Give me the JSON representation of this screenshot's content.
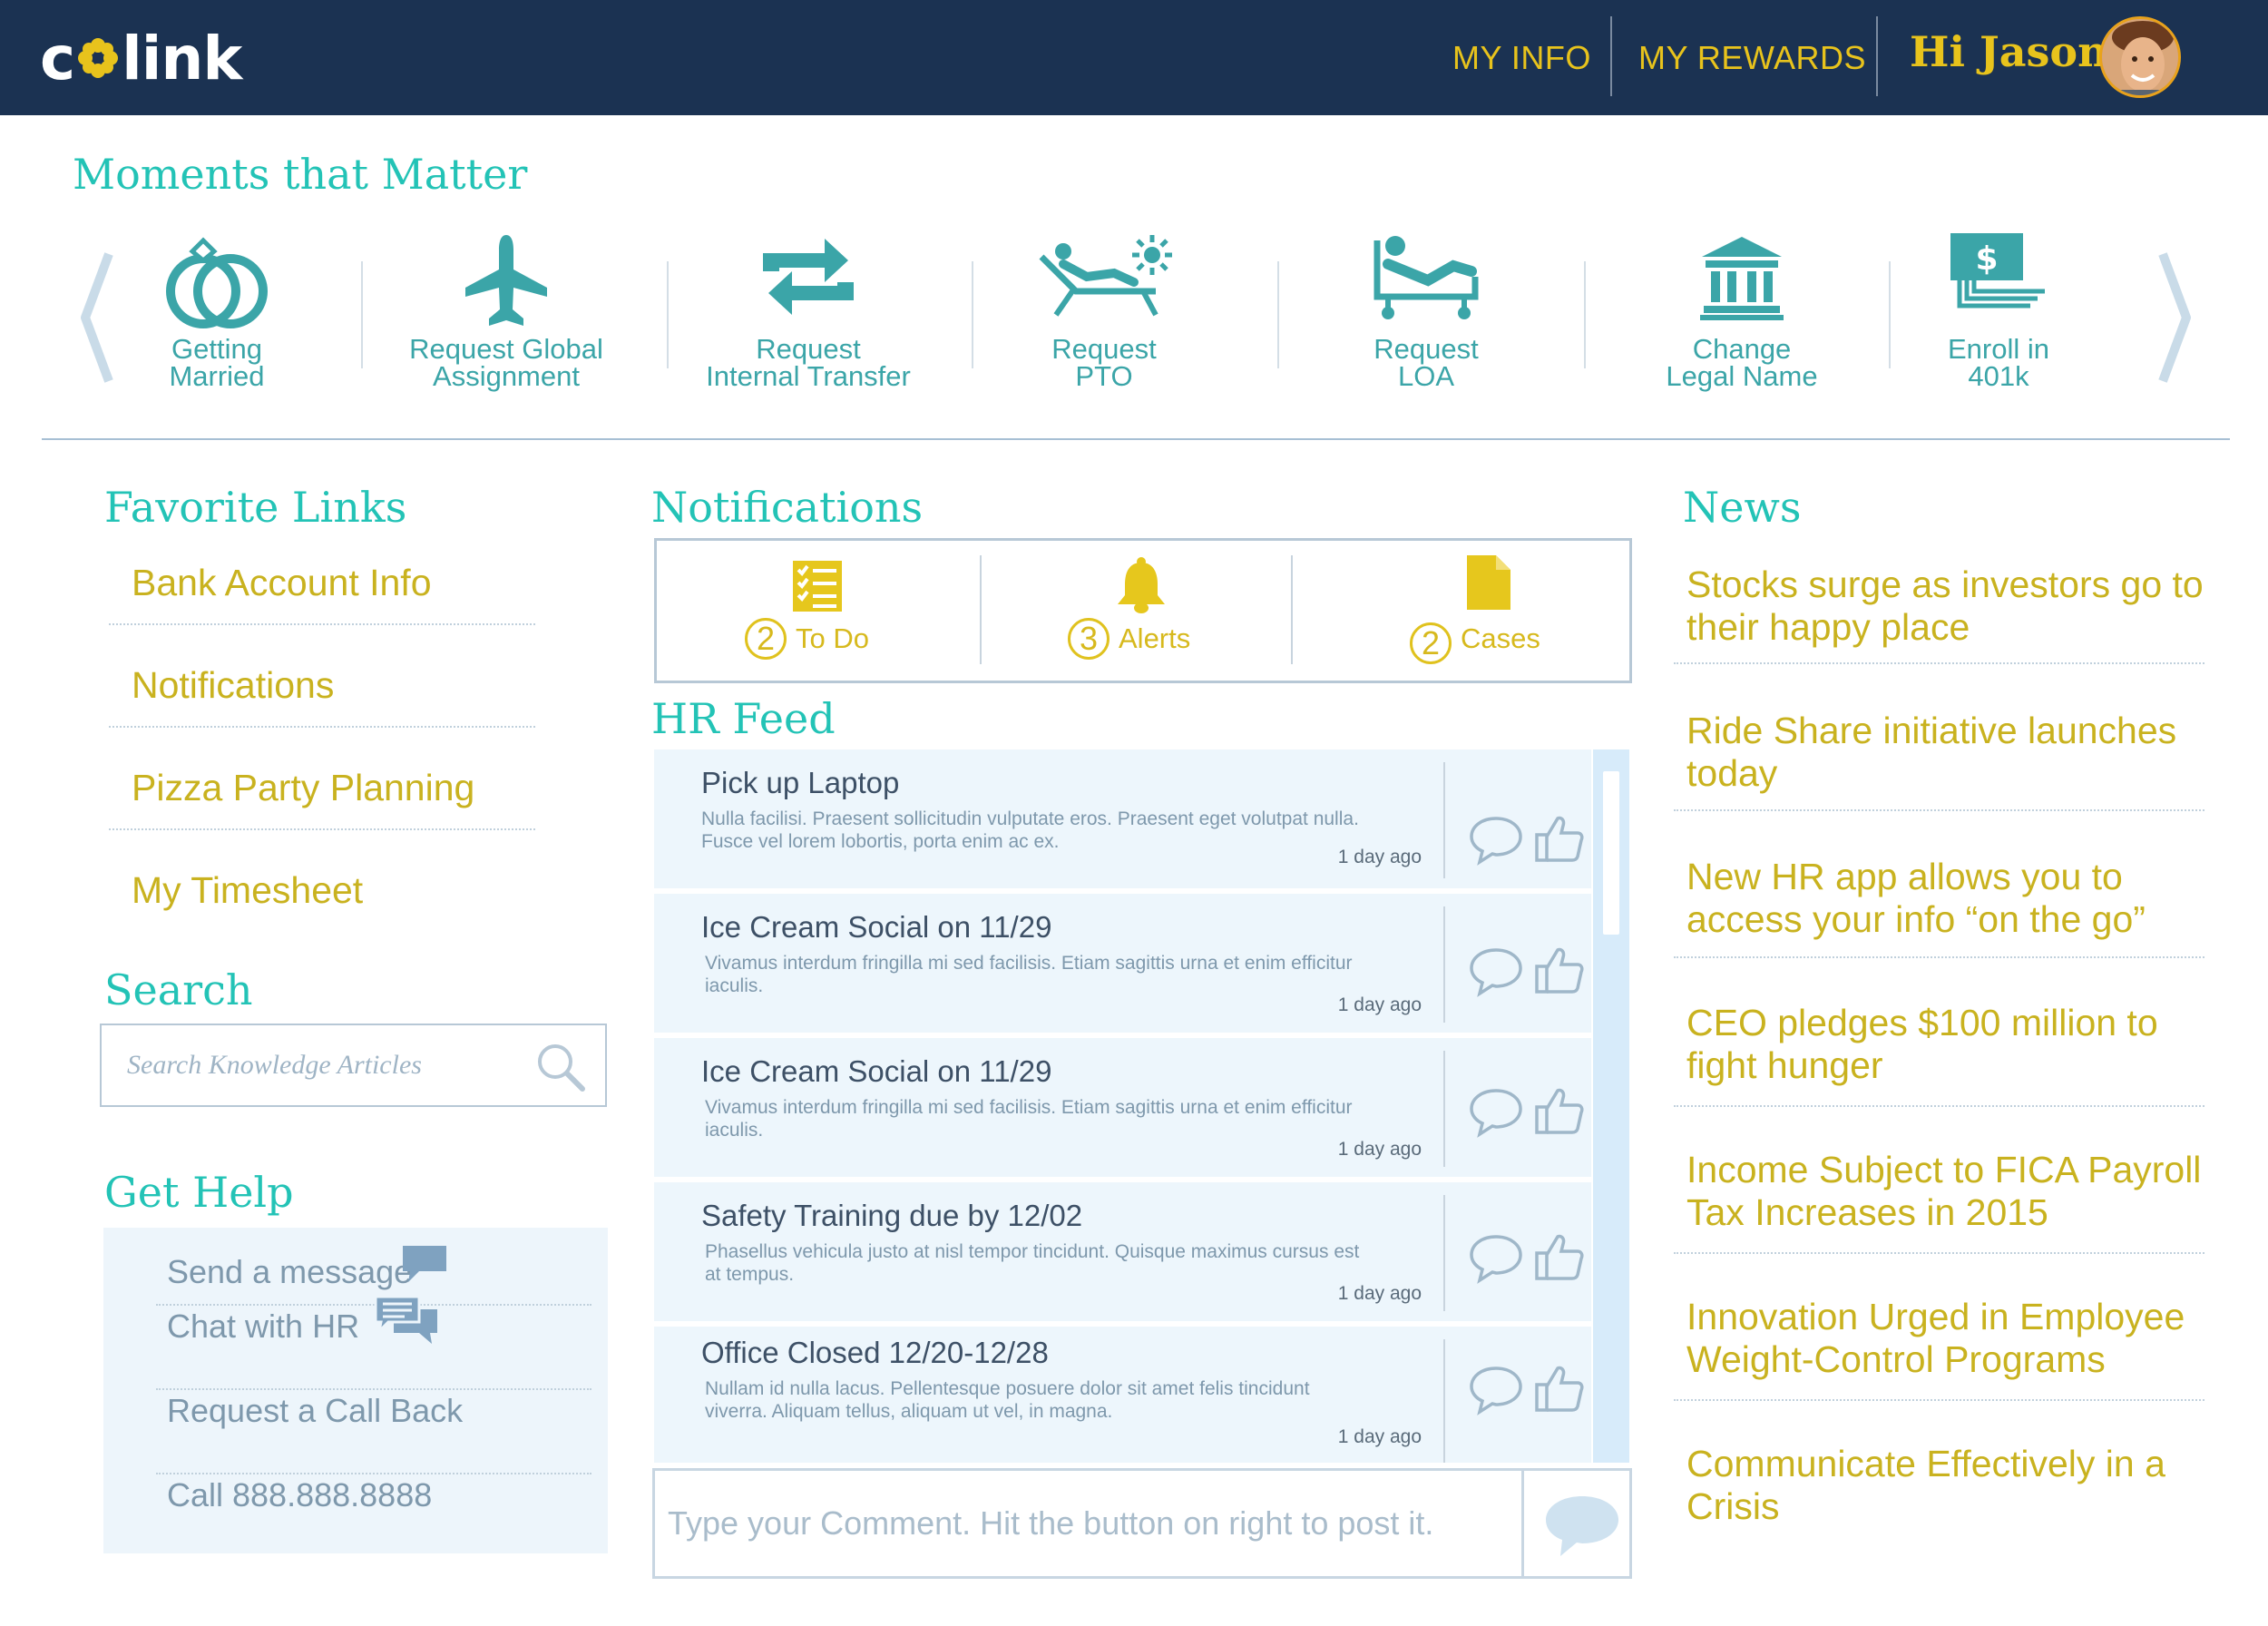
{
  "header": {
    "logo_left": "c",
    "logo_right": "link",
    "nav": [
      {
        "label": "MY INFO"
      },
      {
        "label": "MY REWARDS"
      }
    ],
    "greeting": "Hi Jason"
  },
  "moments": {
    "title": "Moments that Matter",
    "items": [
      {
        "line1": "Getting",
        "line2": "Married",
        "icon": "rings-icon"
      },
      {
        "line1": "Request Global",
        "line2": "Assignment",
        "icon": "airplane-icon"
      },
      {
        "line1": "Request",
        "line2": "Internal Transfer",
        "icon": "transfer-icon"
      },
      {
        "line1": "Request",
        "line2": "PTO",
        "icon": "beach-chair-icon"
      },
      {
        "line1": "Request",
        "line2": "LOA",
        "icon": "hospital-bed-icon"
      },
      {
        "line1": "Change",
        "line2": "Legal Name",
        "icon": "courthouse-icon"
      },
      {
        "line1": "Enroll in",
        "line2": "401k",
        "icon": "money-stack-icon"
      }
    ]
  },
  "favorites": {
    "title": "Favorite Links",
    "items": [
      "Bank Account Info",
      "Notifications",
      "Pizza Party Planning",
      "My Timesheet"
    ]
  },
  "search": {
    "title": "Search",
    "placeholder": "Search Knowledge Articles"
  },
  "help": {
    "title": "Get Help",
    "items": [
      "Send a message",
      "Chat with HR",
      "Request a Call Back",
      "Call 888.888.8888"
    ]
  },
  "notifications": {
    "title": "Notifications",
    "items": [
      {
        "count": "2",
        "label": "To Do",
        "icon": "checklist-icon"
      },
      {
        "count": "3",
        "label": "Alerts",
        "icon": "bell-icon"
      },
      {
        "count": "2",
        "label": "Cases",
        "icon": "document-icon"
      }
    ]
  },
  "feed": {
    "title": "HR Feed",
    "posts": [
      {
        "title": "Pick up Laptop",
        "body": "Nulla facilisi. Praesent sollicitudin vulputate eros. Praesent eget volutpat nulla. Fusce vel lorem lobortis, porta enim ac ex.",
        "age": "1 day ago"
      },
      {
        "title": "Ice Cream Social on 11/29",
        "body": "Vivamus interdum fringilla mi sed facilisis. Etiam sagittis urna et enim efficitur iaculis.",
        "age": "1 day ago"
      },
      {
        "title": "Ice Cream Social on 11/29",
        "body": "Vivamus interdum fringilla mi sed facilisis. Etiam sagittis urna et enim efficitur iaculis.",
        "age": "1 day ago"
      },
      {
        "title": "Safety Training due by 12/02",
        "body": "Phasellus vehicula justo at nisl tempor tincidunt. Quisque maximus cursus est at tempus.",
        "age": "1 day ago"
      },
      {
        "title": "Office Closed 12/20-12/28",
        "body": "Nullam id nulla lacus. Pellentesque posuere dolor sit amet felis tincidunt viverra. Aliquam tellus, aliquam ut vel, in magna.",
        "age": "1 day ago"
      }
    ]
  },
  "comment": {
    "placeholder": "Type your Comment. Hit the button on right to post it."
  },
  "news": {
    "title": "News",
    "items": [
      "Stocks surge as investors go to their happy place",
      "Ride Share initiative launches today",
      "New HR app allows you to access your info “on the go”",
      "CEO pledges $100 million to fight hunger",
      "Income Subject to FICA Payroll Tax Increases in 2015",
      "Innovation Urged in Employee Weight-Control Programs",
      "Communicate Effectively in a Crisis"
    ]
  },
  "colors": {
    "header_bg": "#1b3252",
    "accent_yellow": "#e8c31c",
    "accent_teal": "#23c3b6",
    "icon_teal": "#3ba5a8",
    "link_gold": "#c9b21f",
    "feed_bg": "#edf6fc"
  }
}
